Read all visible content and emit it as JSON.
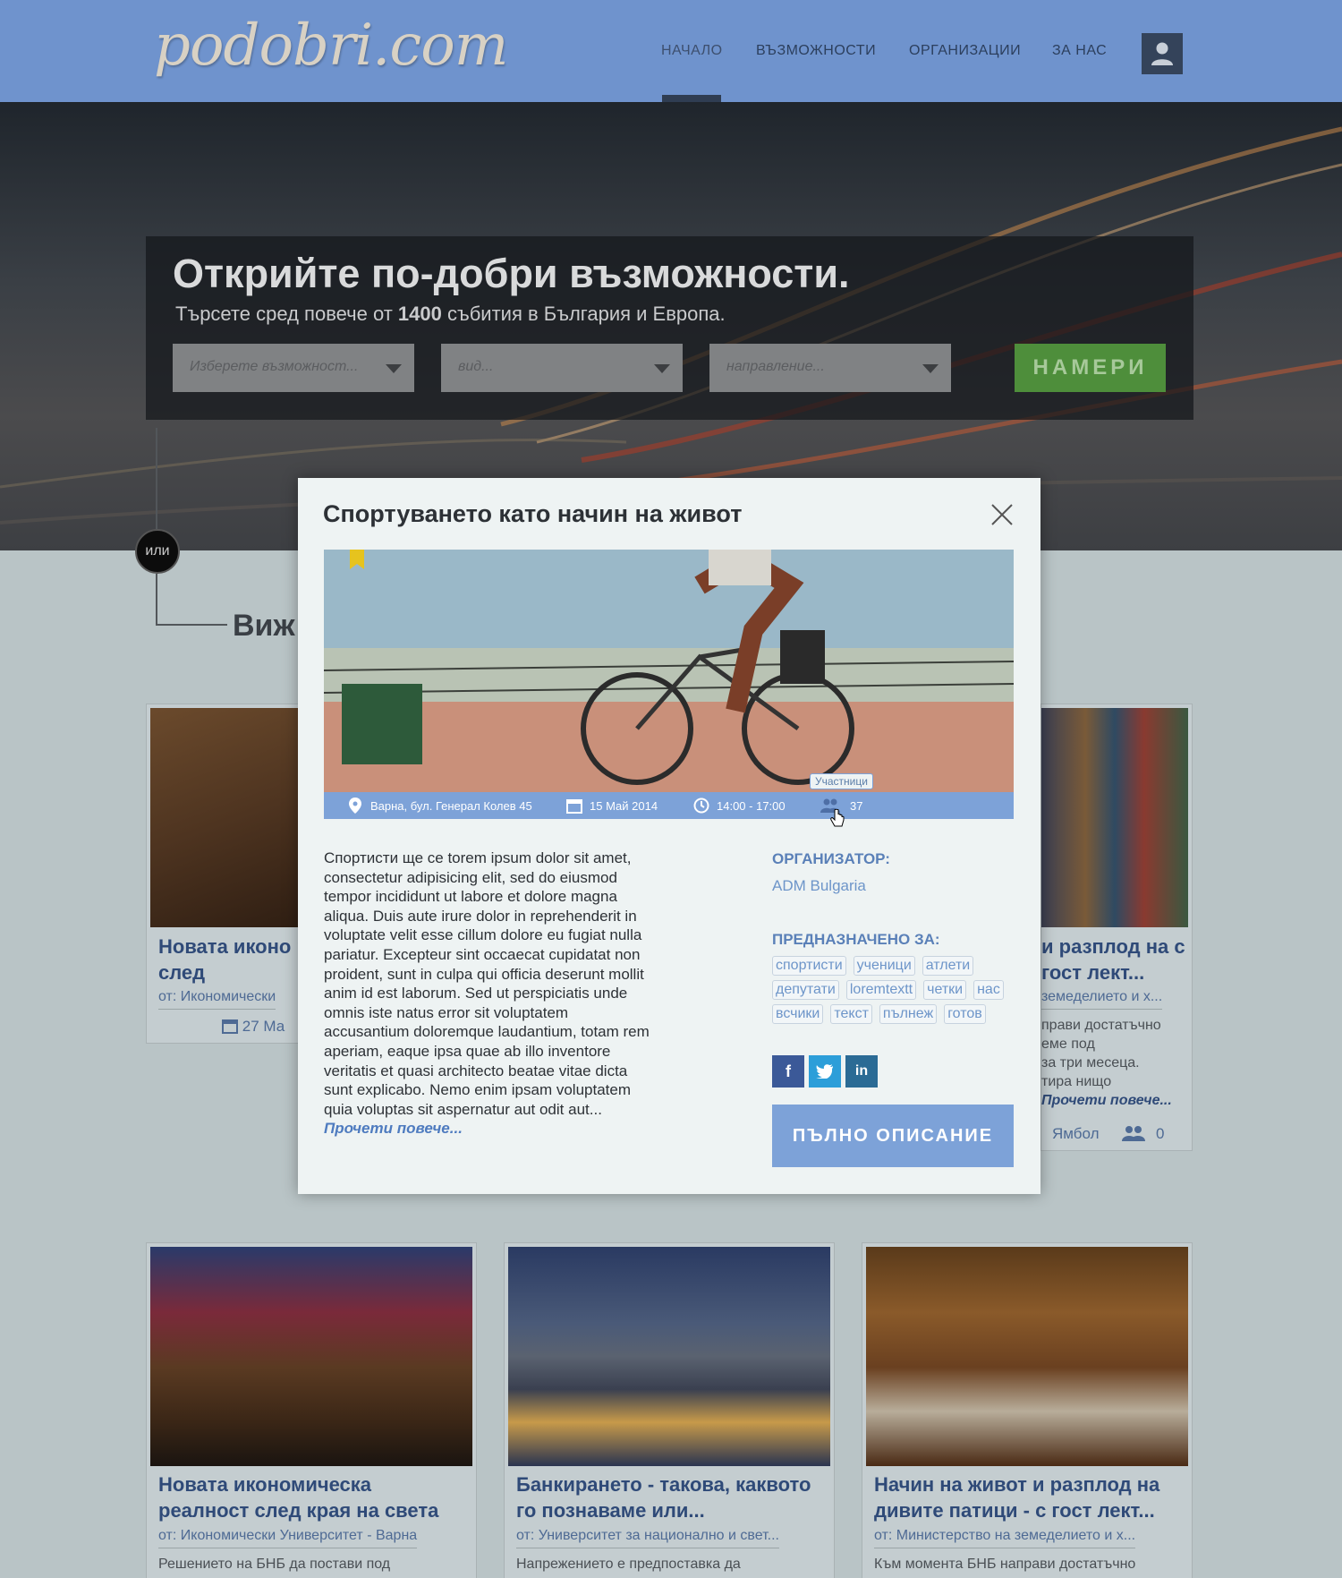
{
  "header": {
    "logo": "podobri.com",
    "nav": [
      {
        "label": "НАЧАЛО",
        "active": true
      },
      {
        "label": "ВЪЗМОЖНОСТИ"
      },
      {
        "label": "ОРГАНИЗАЦИИ"
      },
      {
        "label": "ЗА НАС"
      }
    ],
    "user_icon": "user-icon"
  },
  "hero": {
    "title": "Открийте по-добри възможности.",
    "subtitle_pre": "Търсете сред повече от ",
    "subtitle_count": "1400",
    "subtitle_post": " събития в България и Европа.",
    "selects": [
      {
        "placeholder": "Изберете възможност..."
      },
      {
        "placeholder": "вид..."
      },
      {
        "placeholder": "направление..."
      }
    ],
    "find_label": "НАМЕРИ",
    "or_label": "или",
    "see_label": "Виж"
  },
  "cards_row1": [
    {
      "title": "Новата иконо реалност след",
      "from": "от: Икономически",
      "date": "27 Ма"
    },
    {
      "title": "и разплод на с гост лект...",
      "from": "земеделието и х...",
      "text": "прави достатъчно\nеме под\nза три месеца.\nтира нищо",
      "more": "Прочети повече...",
      "city": "Ямбол",
      "count": "0"
    }
  ],
  "cards_row2": [
    {
      "title": "Новата икономическа реалност след края на света",
      "from": "от: Икономически Университет - Варна",
      "text": "Решението на БНБ да постави под"
    },
    {
      "title": "Банкирането - такова, каквото го познаваме или...",
      "from": "от: Университет за национално и свет...",
      "text": "Напрежението е предпоставка да"
    },
    {
      "title": "Начин на живот и разплод на дивите патици - с гост лект...",
      "from": "от: Министерство на земеделието и х...",
      "text": "Към момента БНБ направи достатъчно"
    }
  ],
  "modal": {
    "title": "Спортуването като начин на живот",
    "location": "Варна, бул. Генерал Колев 45",
    "date": "15 Май 2014",
    "time": "14:00 - 17:00",
    "participants": "37",
    "participants_tooltip": "Участници",
    "description": "Спортисти ще се torem ipsum dolor sit amet, consectetur adipisicing elit, sed do eiusmod tempor incididunt ut labore et dolore magna aliqua. Duis aute irure dolor in reprehenderit in voluptate velit esse cillum dolore eu fugiat nulla pariatur. Excepteur sint occaecat cupidatat non proident, sunt in culpa qui officia deserunt mollit anim id est laborum. Sed ut perspiciatis unde omnis iste natus error sit voluptatem accusantium doloremque laudantium, totam rem aperiam, eaque ipsa quae ab illo inventore veritatis et quasi architecto beatae vitae dicta sunt explicabo. Nemo enim ipsam voluptatem quia voluptas sit aspernatur aut odit aut...",
    "read_more": "Прочети повече...",
    "organizer_label": "ОРГАНИЗАТОР:",
    "organizer": "ADM Bulgaria",
    "intended_label": "ПРЕДНАЗНАЧЕНО ЗА:",
    "tags": [
      "спортисти",
      "ученици",
      "атлети",
      "депутати",
      "loremtextt",
      "четки",
      "нас",
      "всчики",
      "текст",
      "пълнеж",
      "готов"
    ],
    "social": [
      "f",
      "t",
      "in"
    ],
    "full_button": "ПЪЛНО ОПИСАНИЕ"
  },
  "colors": {
    "header": "#6f93cd",
    "accent": "#7da2d8",
    "find": "#4e8e3b"
  }
}
